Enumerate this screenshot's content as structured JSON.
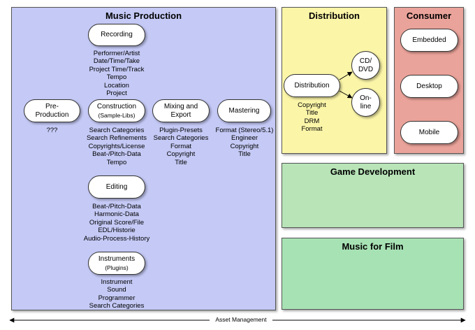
{
  "panels": {
    "music_production": "Music Production",
    "distribution": "Distribution",
    "consumer": "Consumer",
    "game_development": "Game Development",
    "music_for_film": "Music for Film"
  },
  "nodes": {
    "recording": "Recording",
    "pre_production": {
      "line1": "Pre-",
      "line2": "Production"
    },
    "construction": {
      "line1": "Construction",
      "line2": "(Sample-Libs)"
    },
    "mixing_export": {
      "line1": "Mixing and",
      "line2": "Export"
    },
    "mastering": "Mastering",
    "editing": "Editing",
    "instruments": {
      "line1": "Instruments",
      "line2": "(Plugins)"
    },
    "distribution": "Distribution",
    "cd_dvd": {
      "line1": "CD/",
      "line2": "DVD"
    },
    "online": {
      "line1": "On-",
      "line2": "line"
    },
    "embedded": "Embedded",
    "desktop": "Desktop",
    "mobile": "Mobile"
  },
  "metadata": {
    "recording": [
      "Performer/Artist",
      "Date/Time/Take",
      "Project Time/Track",
      "Tempo",
      "Location",
      "Project"
    ],
    "pre_production": [
      "???"
    ],
    "construction": [
      "Search Categories",
      "Search Refinements",
      "Copyrights/License",
      "Beat-/Pitch-Data",
      "Tempo"
    ],
    "mixing_export": [
      "Plugin-Presets",
      "Search Categories",
      "Format",
      "Copyright",
      "Title"
    ],
    "mastering": [
      "Format (Stereo/5.1)",
      "Engineer",
      "Copyright",
      "Title"
    ],
    "editing": [
      "Beat-/Pitch-Data",
      "Harmonic-Data",
      "Original Score/File",
      "EDL/Historie",
      "Audio-Process-History"
    ],
    "instruments": [
      "Instrument",
      "Sound",
      "Programmer",
      "Search Categories"
    ],
    "distribution": [
      "Copyright",
      "Title",
      "DRM",
      "Format"
    ]
  },
  "asset_management": "Asset Management",
  "colors": {
    "music_production": "#c4c9f5",
    "distribution": "#fbf5a8",
    "consumer": "#eaa39a",
    "game_development": "#b8e4b8",
    "music_for_film": "#a7e2b4"
  }
}
